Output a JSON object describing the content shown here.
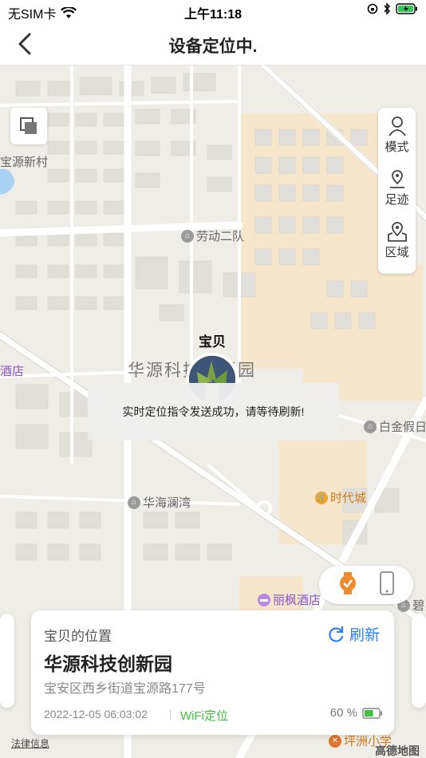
{
  "status": {
    "carrier": "无SIM卡",
    "time": "上午11:18"
  },
  "nav": {
    "title": "设备定位中."
  },
  "map": {
    "pois": {
      "baoyuan_village": "宝源新村",
      "laodong": "劳动二队",
      "huayuan_park": "华源科技创新园",
      "hotel_left": "酒店",
      "baijin": "白金假日",
      "shidai": "时代城",
      "huahai": "华海澜湾",
      "lifeng": "丽枫酒店",
      "bi": "碧",
      "pingzhou": "坪洲小学"
    }
  },
  "side_tools": [
    {
      "label": "模式",
      "icon": "person-icon"
    },
    {
      "label": "足迹",
      "icon": "footprint-pin-icon"
    },
    {
      "label": "区域",
      "icon": "region-pin-icon"
    }
  ],
  "marker": {
    "label": "宝贝"
  },
  "toast": {
    "text": "实时定位指令发送成功，请等待刷新!"
  },
  "card": {
    "heading": "宝贝的位置",
    "refresh": "刷新",
    "name": "华源科技创新园",
    "address": "宝安区西乡街道宝源路177号",
    "time": "2022-12-05 06:03:02",
    "location_type": "WiFi定位",
    "battery": "60 %",
    "battery_level": 0.6
  },
  "footer": {
    "legal": "法律信息",
    "logo": "高德地图"
  },
  "colors": {
    "accent": "#2d7ff0",
    "green": "#3fc13f",
    "orange": "#f08a2e"
  }
}
